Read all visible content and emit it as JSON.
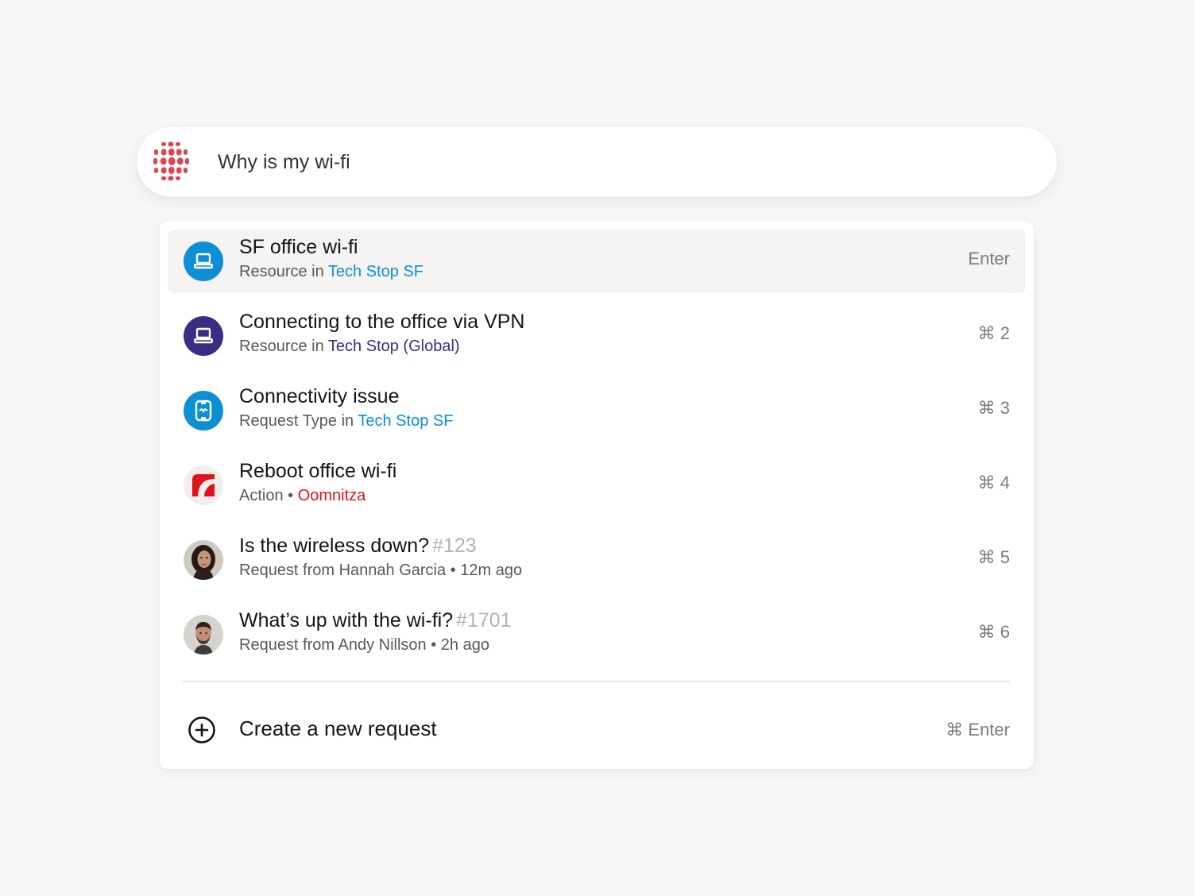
{
  "search": {
    "value": "Why is my wi-fi",
    "logo_icon": "dot-grid-logo-icon",
    "logo_color": "#e0444f"
  },
  "results": [
    {
      "icon": "laptop-icon",
      "icon_bg": "#0c8fd4",
      "title": "SF office wi-fi",
      "number": "",
      "sub_prefix": "Resource in ",
      "sub_link": "Tech Stop SF",
      "shortcut": "Enter",
      "selected": true
    },
    {
      "icon": "laptop-icon",
      "icon_bg": "#3b2d83",
      "title": "Connecting to the office via VPN",
      "number": "",
      "sub_prefix": "Resource in ",
      "sub_link": "Tech Stop (Global)",
      "shortcut": "⌘ 2"
    },
    {
      "icon": "request-type-icon",
      "icon_bg": "#0c8fd4",
      "title": "Connectivity issue",
      "number": "",
      "sub_prefix": "Request Type in ",
      "sub_link": "Tech Stop SF",
      "shortcut": "⌘ 3"
    },
    {
      "icon": "oomnitza-logo-icon",
      "icon_bg": "#f0efed",
      "title": "Reboot office wi-fi",
      "number": "",
      "sub_prefix": "Action • ",
      "sub_link": "Oomnitza",
      "shortcut": "⌘ 4"
    },
    {
      "icon": "avatar-hannah-icon",
      "title": "Is the wireless down?",
      "number": "#123",
      "sub_prefix": "Request from Hannah Garcia • 12m ago",
      "sub_link": "",
      "shortcut": "⌘ 5"
    },
    {
      "icon": "avatar-andy-icon",
      "title": "What’s up with the wi-fi?",
      "number": "#1701",
      "sub_prefix": "Request from Andy Nillson • 2h ago",
      "sub_link": "",
      "shortcut": "⌘ 6"
    }
  ],
  "create": {
    "icon": "plus-circle-icon",
    "label": "Create a new request",
    "shortcut": "⌘ Enter"
  }
}
